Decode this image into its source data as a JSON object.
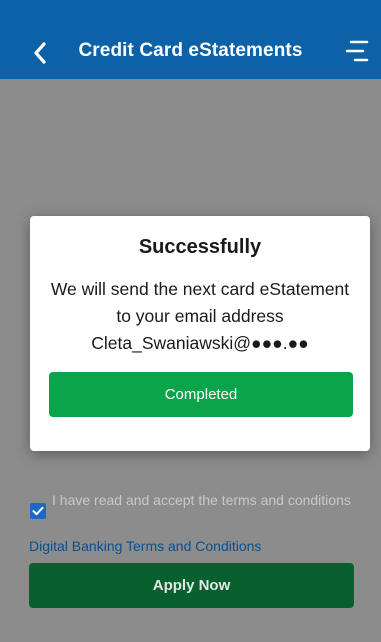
{
  "header": {
    "title": "Credit Card eStatements",
    "back_icon": "chevron-left-icon",
    "menu_icon": "menu-icon"
  },
  "modal": {
    "title": "Successfully",
    "body": "We will send the next card eStatement to your email address Cleta_Swaniawski@●●●.●●",
    "button_label": "Completed"
  },
  "terms": {
    "checked": true,
    "text": "I have read and accept the terms and conditions",
    "link_text": "Digital Banking Terms and Conditions"
  },
  "footer": {
    "apply_label": "Apply Now"
  },
  "colors": {
    "header": "#0d61a6",
    "overlay": "#8c8c8c",
    "primary_button": "#0ba44a",
    "apply_button": "#07612f"
  }
}
